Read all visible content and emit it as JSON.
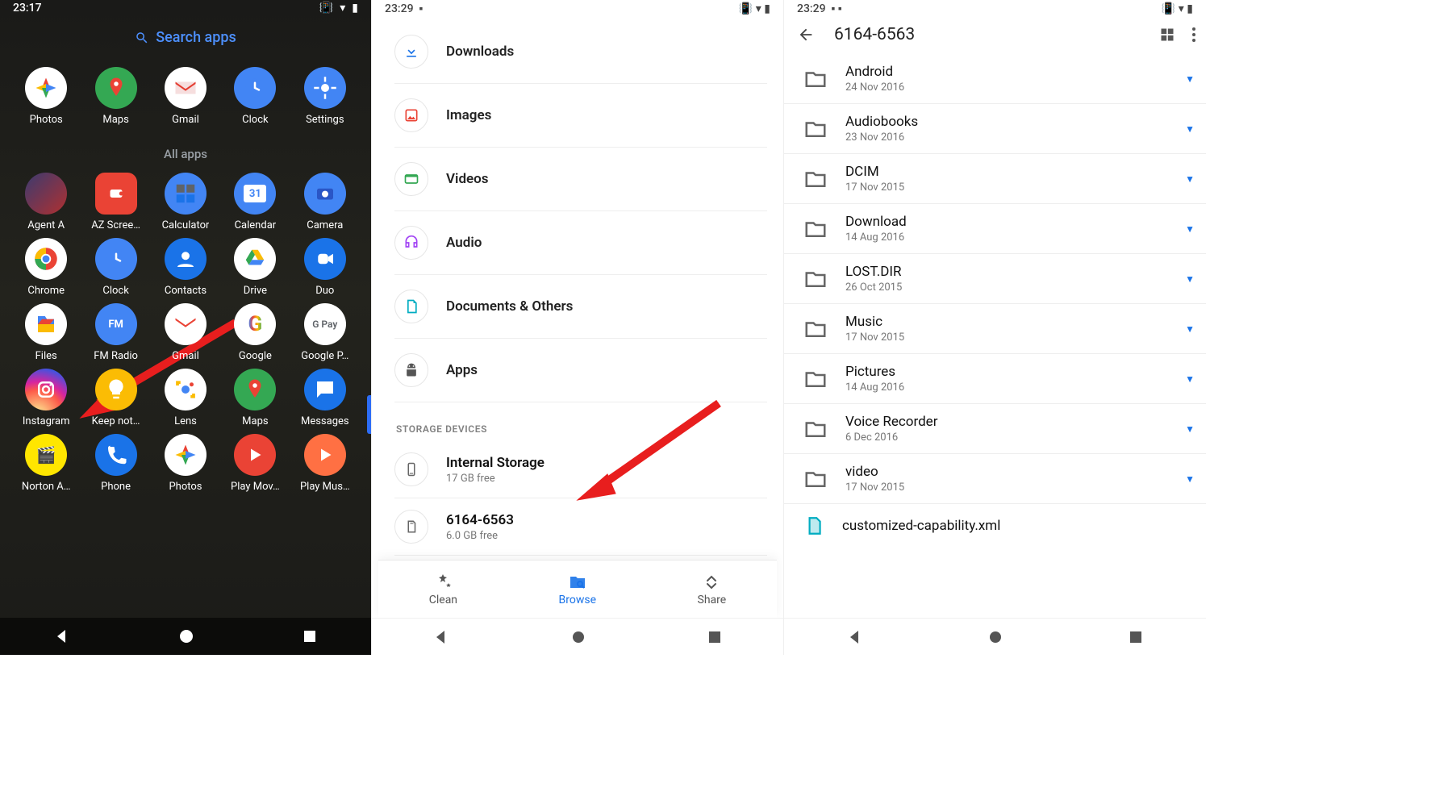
{
  "panel1": {
    "status": {
      "time": "23:17"
    },
    "search_placeholder": "Search apps",
    "favorites": [
      {
        "name": "Photos"
      },
      {
        "name": "Maps"
      },
      {
        "name": "Gmail"
      },
      {
        "name": "Clock"
      },
      {
        "name": "Settings"
      }
    ],
    "all_apps_label": "All apps",
    "apps_row1": [
      {
        "name": "Agent A"
      },
      {
        "name": "AZ Scree…"
      },
      {
        "name": "Calculator"
      },
      {
        "name": "Calendar"
      },
      {
        "name": "Camera"
      }
    ],
    "apps_row2": [
      {
        "name": "Chrome"
      },
      {
        "name": "Clock"
      },
      {
        "name": "Contacts"
      },
      {
        "name": "Drive"
      },
      {
        "name": "Duo"
      }
    ],
    "apps_row3": [
      {
        "name": "Files"
      },
      {
        "name": "FM Radio"
      },
      {
        "name": "Gmail"
      },
      {
        "name": "Google"
      },
      {
        "name": "Google P…"
      }
    ],
    "apps_row4": [
      {
        "name": "Instagram"
      },
      {
        "name": "Keep not…"
      },
      {
        "name": "Lens"
      },
      {
        "name": "Maps"
      },
      {
        "name": "Messages"
      }
    ],
    "apps_row5": [
      {
        "name": "Norton A…"
      },
      {
        "name": "Phone"
      },
      {
        "name": "Photos"
      },
      {
        "name": "Play Mov…"
      },
      {
        "name": "Play Mus…"
      }
    ]
  },
  "panel2": {
    "status": {
      "time": "23:29"
    },
    "categories": [
      {
        "name": "Downloads",
        "icon": "download",
        "color": "#1a73e8"
      },
      {
        "name": "Images",
        "icon": "image",
        "color": "#ea4335"
      },
      {
        "name": "Videos",
        "icon": "video",
        "color": "#34a853"
      },
      {
        "name": "Audio",
        "icon": "audio",
        "color": "#a142f4"
      },
      {
        "name": "Documents & Others",
        "icon": "doc",
        "color": "#00acc1"
      },
      {
        "name": "Apps",
        "icon": "apps",
        "color": "#444"
      }
    ],
    "storage_header": "STORAGE DEVICES",
    "storage": [
      {
        "title": "Internal Storage",
        "sub": "17 GB free",
        "icon": "phone"
      },
      {
        "title": "6164-6563",
        "sub": "6.0 GB free",
        "icon": "sd"
      }
    ],
    "bottombar": [
      {
        "label": "Clean",
        "icon": "clean"
      },
      {
        "label": "Browse",
        "icon": "browse",
        "active": true
      },
      {
        "label": "Share",
        "icon": "share"
      }
    ]
  },
  "panel3": {
    "status": {
      "time": "23:29"
    },
    "title": "6164-6563",
    "folders": [
      {
        "name": "Android",
        "date": "24 Nov 2016"
      },
      {
        "name": "Audiobooks",
        "date": "23 Nov 2016"
      },
      {
        "name": "DCIM",
        "date": "17 Nov 2015"
      },
      {
        "name": "Download",
        "date": "14 Aug 2016"
      },
      {
        "name": "LOST.DIR",
        "date": "26 Oct 2015"
      },
      {
        "name": "Music",
        "date": "17 Nov 2015"
      },
      {
        "name": "Pictures",
        "date": "14 Aug 2016"
      },
      {
        "name": "Voice Recorder",
        "date": "6 Dec 2016"
      },
      {
        "name": "video",
        "date": "17 Nov 2015"
      }
    ],
    "partial_row": "customized-capability.xml"
  }
}
